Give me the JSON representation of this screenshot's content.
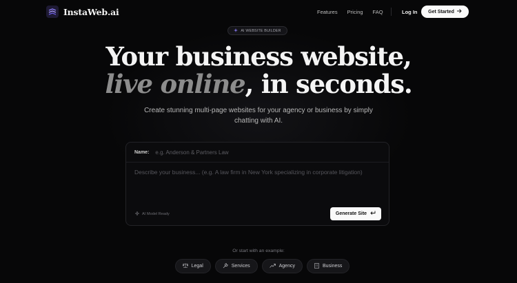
{
  "brand": {
    "name": "InstaWeb.ai"
  },
  "nav": {
    "links": [
      "Features",
      "Pricing",
      "FAQ"
    ],
    "login": "Log In",
    "cta": "Get Started"
  },
  "badge": {
    "label": "AI WEBSITE BUILDER"
  },
  "hero": {
    "line1": "Your business website,",
    "line2_italic": "live online",
    "line2_rest": ", in seconds.",
    "subtitle": "Create stunning multi-page websites for your agency or business by simply chatting with AI."
  },
  "form": {
    "name_label": "Name:",
    "name_placeholder": "e.g. Anderson & Partners Law",
    "description_placeholder": "Describe your business... (e.g. A law firm in New York specializing in corporate litigation)",
    "status": "AI Model Ready",
    "generate_label": "Generate Site"
  },
  "examples": {
    "label": "Or start with an example:",
    "chips": [
      "Legal",
      "Services",
      "Agency",
      "Business"
    ]
  },
  "colors": {
    "background": "#070708",
    "accent": "#8b7cf6",
    "button": "#fafafa"
  }
}
